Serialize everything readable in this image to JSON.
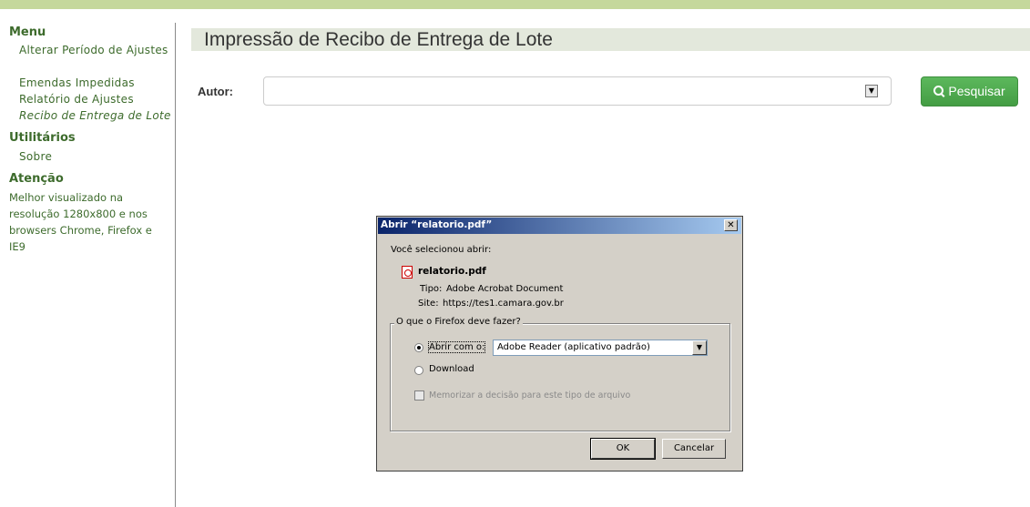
{
  "sidebar": {
    "menu_heading": "Menu",
    "menu_items": [
      {
        "label": "Alterar Período de Ajustes"
      },
      {
        "label": "Emendas Impedidas"
      },
      {
        "label": "Relatório de Ajustes"
      },
      {
        "label": "Recibo de Entrega de Lote"
      }
    ],
    "utilities_heading": "Utilitários",
    "utilities_items": [
      {
        "label": "Sobre"
      }
    ],
    "attention_heading": "Atenção",
    "attention_text": "Melhor visualizado na resolução 1280x800 e nos browsers Chrome, Firefox e IE9"
  },
  "main": {
    "page_title": "Impressão de Recibo de Entrega de Lote",
    "autor_label": "Autor:",
    "autor_value": "",
    "search_button": "Pesquisar"
  },
  "dialog": {
    "title": "Abrir “relatorio.pdf”",
    "intro": "Você selecionou abrir:",
    "file_name": "relatorio.pdf",
    "type_label": "Tipo:",
    "type_value": "Adobe Acrobat Document",
    "site_label": "Site:",
    "site_value": "https://tes1.camara.gov.br",
    "group_label": "O que o Firefox deve fazer?",
    "open_with_label": "Abrir com o:",
    "open_with_app": "Adobe Reader  (aplicativo padrão)",
    "download_label": "Download",
    "remember_label": "Memorizar a decisão para este tipo de arquivo",
    "ok_button": "OK",
    "cancel_button": "Cancelar"
  },
  "colors": {
    "accent_green": "#3d6b2c",
    "button_green": "#5cb85c",
    "title_bar_blue": "#0a246a"
  }
}
